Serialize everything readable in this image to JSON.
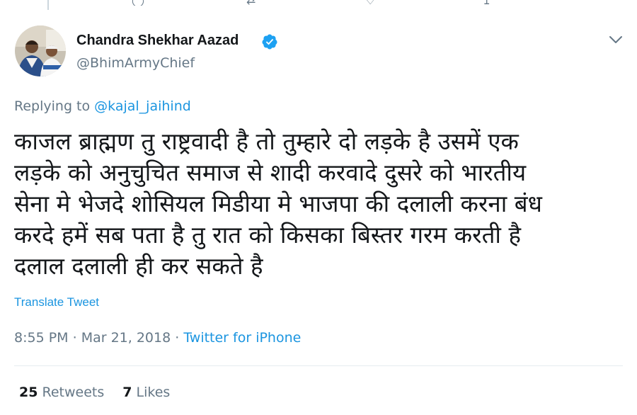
{
  "author": {
    "display_name": "Chandra Shekhar Aazad",
    "handle": "@BhimArmyChief",
    "verified": true
  },
  "reply": {
    "prefix": "Replying to",
    "mention": "@kajal_jaihind"
  },
  "tweet": {
    "lines": [
      "काजल ब्राह्मण तु राष्ट्रवादी है तो तुम्हारे दो लड़के है उसमें एक",
      "लड़के को अनुचुचित समाज से शादी करवादे दुसरे को भारतीय",
      "सेना मे भेजदे शोसियल मिडीया मे भाजपा की दलाली करना बंध",
      "करदे हमें सब पता है तु रात को किसका बिस्तर गरम करती है",
      "दलाल दलाली ही कर सकते है"
    ],
    "translate_label": "Translate Tweet"
  },
  "meta": {
    "time": "8:55 PM",
    "separator": " · ",
    "date": "Mar 21, 2018",
    "source": "Twitter for iPhone"
  },
  "stats": {
    "retweets_count": "25",
    "retweets_label": "Retweets",
    "likes_count": "7",
    "likes_label": "Likes"
  },
  "colors": {
    "link": "#1b95e0",
    "secondary_text": "#657786",
    "primary_text": "#14171a",
    "verified_badge": "#1da1f2"
  },
  "icons": [
    "verified-badge-icon",
    "chevron-down-icon",
    "reply-icon",
    "retweet-icon",
    "like-icon",
    "share-icon"
  ]
}
